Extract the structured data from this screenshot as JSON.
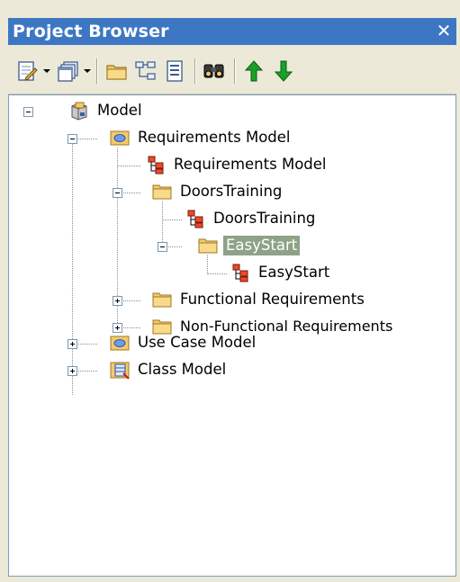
{
  "panel": {
    "title": "Project Browser",
    "close_glyph": "✕"
  },
  "toolbar": {
    "buttons": [
      {
        "icon": "new-element-icon",
        "dropdown": true
      },
      {
        "icon": "new-diagram-icon",
        "dropdown": true
      },
      {
        "icon": "new-package-icon",
        "dropdown": false
      },
      {
        "icon": "hierarchy-icon",
        "dropdown": false
      },
      {
        "icon": "properties-icon",
        "dropdown": false
      },
      {
        "icon": "find-icon",
        "dropdown": false
      },
      {
        "icon": "move-up-icon",
        "dropdown": false
      },
      {
        "icon": "move-down-icon",
        "dropdown": false
      }
    ]
  },
  "tree": {
    "root": {
      "label": "Model",
      "icon": "model-root-icon",
      "expanded": true
    },
    "requirements_model": {
      "label": "Requirements Model",
      "icon": "view-package-icon",
      "expanded": true
    },
    "requirements_model_diagram": {
      "label": "Requirements Model",
      "icon": "diagram-icon"
    },
    "doors_training": {
      "label": "DoorsTraining",
      "icon": "folder-icon",
      "expanded": true
    },
    "doors_training_diagram": {
      "label": "DoorsTraining",
      "icon": "diagram-icon"
    },
    "easy_start": {
      "label": "EasyStart",
      "icon": "folder-icon",
      "expanded": true,
      "selected": true
    },
    "easy_start_diagram": {
      "label": "EasyStart",
      "icon": "diagram-icon"
    },
    "functional_requirements": {
      "label": "Functional Requirements",
      "icon": "folder-icon",
      "expanded": false
    },
    "non_functional_requirements": {
      "label": "Non-Functional Requirements",
      "icon": "folder-icon",
      "expanded": false
    },
    "use_case_model": {
      "label": "Use Case Model",
      "icon": "view-package-icon",
      "expanded": false
    },
    "class_model": {
      "label": "Class Model",
      "icon": "class-view-icon",
      "expanded": false
    }
  },
  "colors": {
    "title_bar": "#3d77c4",
    "selection": "#8ea287",
    "folder": "#f5c96b",
    "arrow_green": "#1aa12a"
  }
}
